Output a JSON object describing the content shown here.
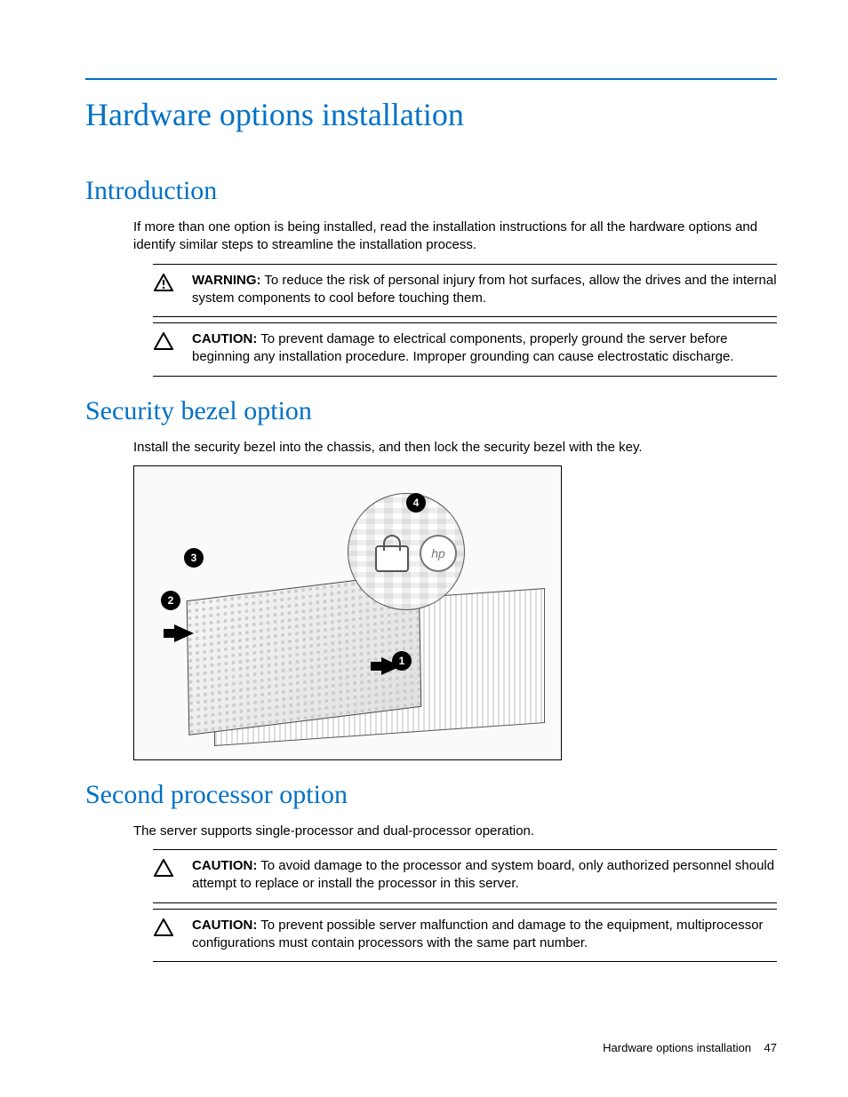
{
  "page_title": "Hardware options installation",
  "sections": {
    "intro": {
      "heading": "Introduction",
      "body": "If more than one option is being installed, read the installation instructions for all the hardware options and identify similar steps to streamline the installation process.",
      "warning": {
        "label": "WARNING:",
        "text": "To reduce the risk of personal injury from hot surfaces, allow the drives and the internal system components to cool before touching them."
      },
      "caution": {
        "label": "CAUTION:",
        "text": "To prevent damage to electrical components, properly ground the server before beginning any installation procedure. Improper grounding can cause electrostatic discharge."
      }
    },
    "bezel": {
      "heading": "Security bezel option",
      "body": "Install the security bezel into the chassis, and then lock the security bezel with the key.",
      "callouts": [
        "1",
        "2",
        "3",
        "4"
      ],
      "hp_label": "hp"
    },
    "processor": {
      "heading": "Second processor option",
      "body": "The server supports single-processor and dual-processor operation.",
      "caution1": {
        "label": "CAUTION:",
        "text": "To avoid damage to the processor and system board, only authorized personnel should attempt to replace or install the processor in this server."
      },
      "caution2": {
        "label": "CAUTION:",
        "text": "To prevent possible server malfunction and damage to the equipment, multiprocessor configurations must contain processors with the same part number."
      }
    }
  },
  "footer": {
    "section_name": "Hardware options installation",
    "page_number": "47"
  }
}
